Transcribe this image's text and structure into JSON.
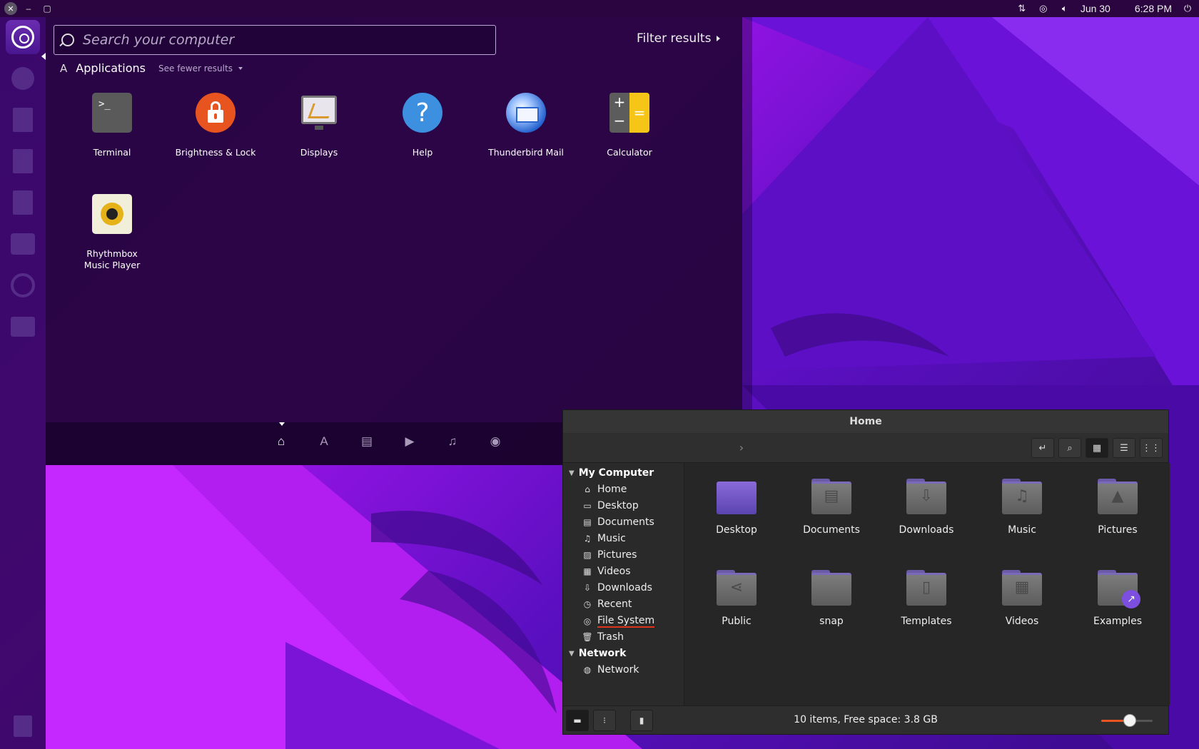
{
  "window_controls": {
    "close": "✕",
    "minimize": "–",
    "maximize": "▢"
  },
  "tray": {
    "date": "Jun 30",
    "time": "6:28 PM"
  },
  "dash": {
    "search_placeholder": "Search your computer",
    "filter_label": "Filter results",
    "category_title": "Applications",
    "fewer_results": "See fewer results",
    "apps": [
      {
        "name": "Terminal",
        "icon": "terminal-icon"
      },
      {
        "name": "Brightness & Lock",
        "icon": "lock-icon"
      },
      {
        "name": "Displays",
        "icon": "display-icon"
      },
      {
        "name": "Help",
        "icon": "help-icon"
      },
      {
        "name": "Thunderbird Mail",
        "icon": "thunderbird-icon"
      },
      {
        "name": "Calculator",
        "icon": "calculator-icon"
      },
      {
        "name": "Rhythmbox Music Player",
        "icon": "rhythmbox-icon"
      }
    ],
    "lenses": [
      "home",
      "applications",
      "files",
      "videos",
      "music",
      "photos"
    ]
  },
  "file_manager": {
    "title": "Home",
    "sidebar": {
      "section_computer": "My Computer",
      "items": [
        "Home",
        "Desktop",
        "Documents",
        "Music",
        "Pictures",
        "Videos",
        "Downloads",
        "Recent",
        "File System",
        "Trash"
      ],
      "section_network": "Network",
      "network_items": [
        "Network"
      ]
    },
    "folders": [
      "Desktop",
      "Documents",
      "Downloads",
      "Music",
      "Pictures",
      "Public",
      "snap",
      "Templates",
      "Videos",
      "Examples"
    ],
    "status": "10 items, Free space: 3.8 GB",
    "zoom_fraction": 0.55
  },
  "colors": {
    "accent": "#e95420",
    "panel": "#2a0540"
  }
}
